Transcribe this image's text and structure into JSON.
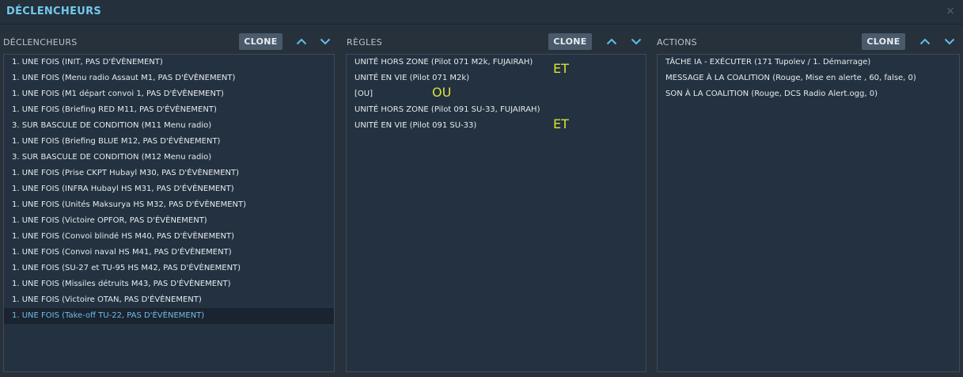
{
  "window": {
    "title": "DÉCLENCHEURS",
    "close_glyph": "×"
  },
  "triggers": {
    "label": "DÉCLENCHEURS",
    "clone_label": "CLONE",
    "items": [
      "1. UNE FOIS (INIT, PAS D'ÉVÈNEMENT)",
      "1. UNE FOIS (Menu radio Assaut M1, PAS D'ÉVÈNEMENT)",
      "1. UNE FOIS (M1 départ convoi 1, PAS D'ÉVÈNEMENT)",
      "1. UNE FOIS (Briefing RED M11, PAS D'ÉVÈNEMENT)",
      "3. SUR BASCULE DE CONDITION (M11 Menu radio)",
      "1. UNE FOIS (Briefing BLUE M12, PAS D'ÉVÈNEMENT)",
      "3. SUR BASCULE DE CONDITION (M12 Menu radio)",
      "1. UNE FOIS (Prise CKPT Hubayl M30, PAS D'ÉVÈNEMENT)",
      "1. UNE FOIS (INFRA Hubayl HS M31, PAS D'ÉVÈNEMENT)",
      "1. UNE FOIS (Unités Maksurya HS M32, PAS D'ÉVÈNEMENT)",
      "1. UNE FOIS (Victoire OPFOR, PAS D'ÉVÈNEMENT)",
      "1. UNE FOIS (Convoi blindé HS M40, PAS D'ÉVÈNEMENT)",
      "1. UNE FOIS (Convoi naval HS M41, PAS D'ÉVÈNEMENT)",
      "1. UNE FOIS (SU-27 et TU-95 HS M42, PAS D'ÉVÈNEMENT)",
      "1. UNE FOIS (Missiles détruits M43, PAS D'ÉVÈNEMENT)",
      "1. UNE FOIS (Victoire OTAN, PAS D'ÉVÈNEMENT)",
      "1. UNE FOIS (Take-off TU-22, PAS D'ÉVÈNEMENT)"
    ],
    "selected_index": 16
  },
  "rules": {
    "label": "RÈGLES",
    "clone_label": "CLONE",
    "items": [
      "UNITÉ HORS ZONE (Pilot 071 M2k, FUJAIRAH)",
      "UNITÉ EN VIE (Pilot 071 M2k)",
      "[OU]",
      "UNITÉ HORS ZONE (Pilot 091 SU-33, FUJAIRAH)",
      "UNITÉ EN VIE (Pilot 091 SU-33)"
    ],
    "annotations": {
      "et_1": "ET",
      "ou": "OU",
      "et_2": "ET"
    }
  },
  "actions": {
    "label": "ACTIONS",
    "clone_label": "CLONE",
    "items": [
      "TÂCHE IA - EXÉCUTER (171 Tupolev / 1. Démarrage)",
      "MESSAGE À LA COALITION (Rouge, Mise en alerte , 60, false, 0)",
      "SON À LA COALITION (Rouge, DCS Radio Alert.ogg, 0)"
    ]
  },
  "icons": {
    "move_up": "chevron-up-icon",
    "move_down": "chevron-down-icon",
    "close": "close-icon"
  },
  "colors": {
    "background": "#27313c",
    "panel": "#243140",
    "accent": "#73c8ea",
    "selected_text": "#6fbde6",
    "button": "#4a5a6b",
    "annotation": "#d6e33a"
  }
}
